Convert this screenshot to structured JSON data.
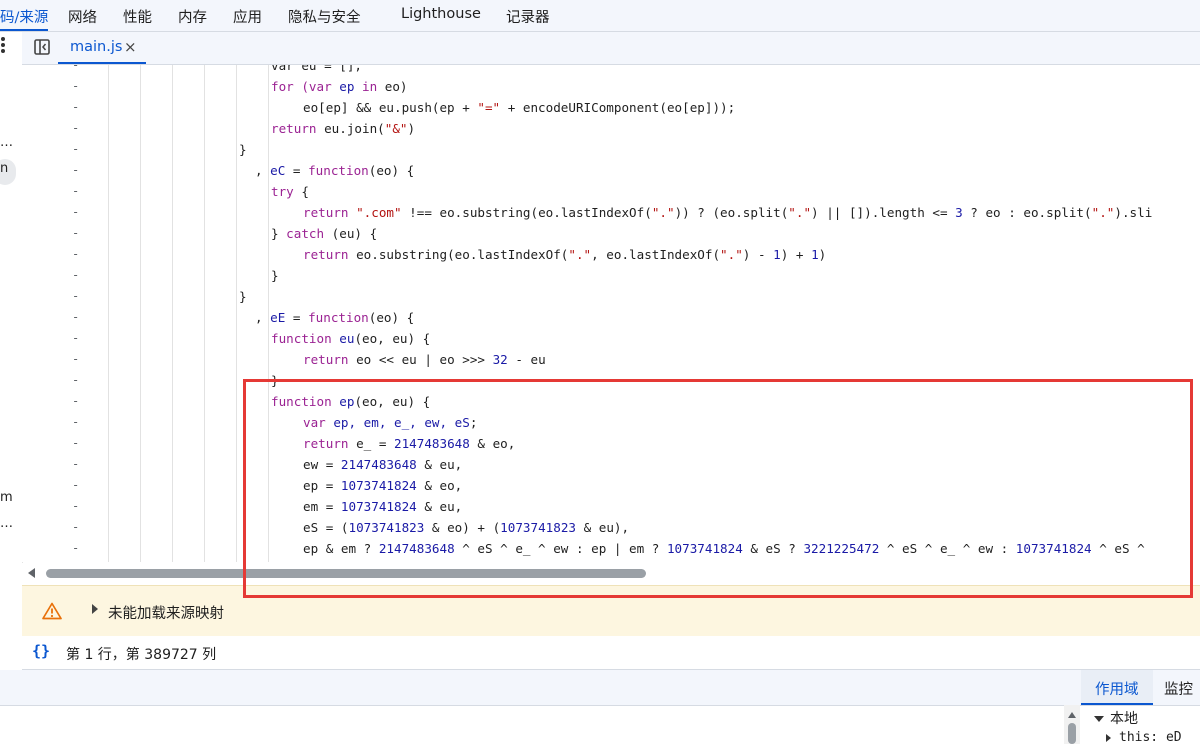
{
  "top_tabs": [
    "码/来源",
    "网络",
    "性能",
    "内存",
    "应用",
    "隐私与安全",
    "Lighthouse",
    "记录器"
  ],
  "left_strip": {
    "glyphs": [
      "…",
      "n",
      "m",
      "…"
    ]
  },
  "file_tab": {
    "label": "main.js",
    "close": "×"
  },
  "gutter_mark": "-",
  "code_lines": [
    [
      {
        "t": "var eu = [];"
      }
    ],
    [
      {
        "t": "for",
        "c": "kw"
      },
      {
        "t": " (var ",
        "c": "kw"
      },
      {
        "t": "ep",
        "c": "def"
      },
      {
        "t": " in ",
        "c": "kw"
      },
      {
        "t": "eo)"
      }
    ],
    [
      {
        "t": "eo[ep] && eu.push(ep + "
      },
      {
        "t": "\"=\"",
        "c": "str"
      },
      {
        "t": " + encodeURIComponent(eo[ep]));"
      }
    ],
    [
      {
        "t": "return",
        "c": "kw"
      },
      {
        "t": " eu.join("
      },
      {
        "t": "\"&\"",
        "c": "str"
      },
      {
        "t": ")"
      }
    ],
    [
      {
        "t": "}"
      }
    ],
    [
      {
        "t": ", "
      },
      {
        "t": "eC",
        "c": "def"
      },
      {
        "t": " = "
      },
      {
        "t": "function",
        "c": "kw"
      },
      {
        "t": "(eo) {"
      }
    ],
    [
      {
        "t": "try",
        "c": "kw"
      },
      {
        "t": " {"
      }
    ],
    [
      {
        "t": "return",
        "c": "kw"
      },
      {
        "t": " "
      },
      {
        "t": "\".com\"",
        "c": "str"
      },
      {
        "t": " !== eo.substring(eo.lastIndexOf("
      },
      {
        "t": "\".\"",
        "c": "str"
      },
      {
        "t": ")) ? (eo.split("
      },
      {
        "t": "\".\"",
        "c": "str"
      },
      {
        "t": ") || []).length <= "
      },
      {
        "t": "3",
        "c": "num"
      },
      {
        "t": " ? eo : eo.split("
      },
      {
        "t": "\".\"",
        "c": "str"
      },
      {
        "t": ").sli"
      }
    ],
    [
      {
        "t": "} "
      },
      {
        "t": "catch",
        "c": "kw"
      },
      {
        "t": " (eu) {"
      }
    ],
    [
      {
        "t": "return",
        "c": "kw"
      },
      {
        "t": " eo.substring(eo.lastIndexOf("
      },
      {
        "t": "\".\"",
        "c": "str"
      },
      {
        "t": ", eo.lastIndexOf("
      },
      {
        "t": "\".\"",
        "c": "str"
      },
      {
        "t": ") - "
      },
      {
        "t": "1",
        "c": "num"
      },
      {
        "t": ") + "
      },
      {
        "t": "1",
        "c": "num"
      },
      {
        "t": ")"
      }
    ],
    [
      {
        "t": "}"
      }
    ],
    [
      {
        "t": "}"
      }
    ],
    [
      {
        "t": ", "
      },
      {
        "t": "eE",
        "c": "def"
      },
      {
        "t": " = "
      },
      {
        "t": "function",
        "c": "kw"
      },
      {
        "t": "(eo) {"
      }
    ],
    [
      {
        "t": "function",
        "c": "kw"
      },
      {
        "t": " "
      },
      {
        "t": "eu",
        "c": "def"
      },
      {
        "t": "(eo, eu) {"
      }
    ],
    [
      {
        "t": "return",
        "c": "kw"
      },
      {
        "t": " eo << eu | eo >>> "
      },
      {
        "t": "32",
        "c": "num"
      },
      {
        "t": " - eu"
      }
    ],
    [
      {
        "t": "}"
      }
    ],
    [
      {
        "t": "function",
        "c": "kw"
      },
      {
        "t": " "
      },
      {
        "t": "ep",
        "c": "def"
      },
      {
        "t": "(eo, eu) {"
      }
    ],
    [
      {
        "t": "var ",
        "c": "kw"
      },
      {
        "t": "ep, em, e_, ew, eS",
        "c": "def"
      },
      {
        "t": ";"
      }
    ],
    [
      {
        "t": "return",
        "c": "kw"
      },
      {
        "t": " e_ = "
      },
      {
        "t": "2147483648",
        "c": "num"
      },
      {
        "t": " & eo,"
      }
    ],
    [
      {
        "t": "ew = "
      },
      {
        "t": "2147483648",
        "c": "num"
      },
      {
        "t": " & eu,"
      }
    ],
    [
      {
        "t": "ep = "
      },
      {
        "t": "1073741824",
        "c": "num"
      },
      {
        "t": " & eo,"
      }
    ],
    [
      {
        "t": "em = "
      },
      {
        "t": "1073741824",
        "c": "num"
      },
      {
        "t": " & eu,"
      }
    ],
    [
      {
        "t": "eS = ("
      },
      {
        "t": "1073741823",
        "c": "num"
      },
      {
        "t": " & eo) + ("
      },
      {
        "t": "1073741823",
        "c": "num"
      },
      {
        "t": " & eu),"
      }
    ],
    [
      {
        "t": "ep & em ? "
      },
      {
        "t": "2147483648",
        "c": "num"
      },
      {
        "t": " ^ eS ^ e_ ^ ew : ep | em ? "
      },
      {
        "t": "1073741824",
        "c": "num"
      },
      {
        "t": " & eS ? "
      },
      {
        "t": "3221225472",
        "c": "num"
      },
      {
        "t": " ^ eS ^ e_ ^ ew : "
      },
      {
        "t": "1073741824",
        "c": "num"
      },
      {
        "t": " ^ eS ^"
      }
    ],
    [
      {
        "t": "}"
      }
    ]
  ],
  "warning": {
    "text": "未能加载来源映射"
  },
  "status": {
    "pretty_icon": "{}",
    "text": "第 1 行，第 389727 列"
  },
  "sidebar": {
    "tabs": [
      "作用域",
      "监控"
    ],
    "scope_local": "本地",
    "scope_this": "this: eD"
  }
}
